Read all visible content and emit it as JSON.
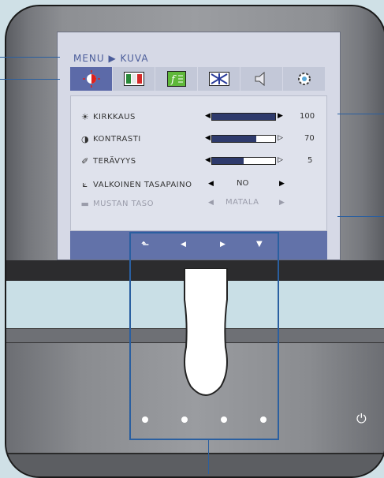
{
  "osd": {
    "title": "MENU ▶ KUVA",
    "tabs": [
      {
        "icon": "brightness-icon",
        "active": true
      },
      {
        "icon": "color-bars-icon",
        "active": false
      },
      {
        "icon": "function-icon",
        "active": false
      },
      {
        "icon": "tracking-icon",
        "active": false
      },
      {
        "icon": "speaker-icon",
        "active": false
      },
      {
        "icon": "settings-icon",
        "active": false
      }
    ],
    "rows": [
      {
        "icon": "☀",
        "label": "KIRKKAUS",
        "value": "100",
        "level": 1.0
      },
      {
        "icon": "◑",
        "label": "KONTRASTI",
        "value": "70",
        "level": 0.7
      },
      {
        "icon": "✐",
        "label": "TERÄVYYS",
        "value": "5",
        "level": 0.5
      }
    ],
    "white_balance": {
      "label": "VALKOINEN TASAPAINO",
      "value": "NO"
    },
    "black_level": {
      "label": "MUSTAN TASO",
      "value": "MATALA"
    },
    "nav": [
      "⬑",
      "◀",
      "▶",
      "▼"
    ]
  },
  "colors": {
    "accent": "#5c6aa8",
    "callout": "#2a5fa0"
  }
}
